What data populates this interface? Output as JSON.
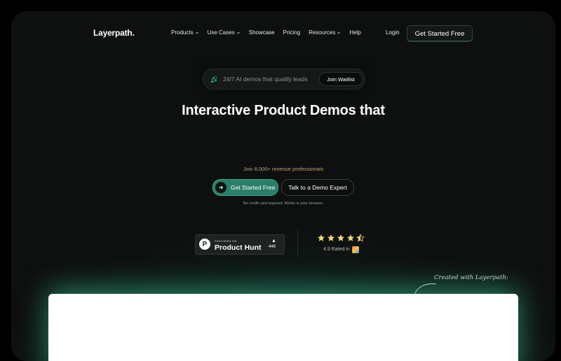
{
  "nav": {
    "logo": "Layerpath",
    "logo_dot": ".",
    "items": [
      {
        "label": "Products",
        "dropdown": true
      },
      {
        "label": "Use Cases",
        "dropdown": true
      },
      {
        "label": "Showcase",
        "dropdown": false
      },
      {
        "label": "Pricing",
        "dropdown": false
      },
      {
        "label": "Resources",
        "dropdown": true
      },
      {
        "label": "Help",
        "dropdown": false
      }
    ],
    "login": "Login",
    "cta": "Get Started Free"
  },
  "announcement": {
    "icon": "party-popper-icon",
    "text": "24/7 AI demos that qualify leads",
    "button": "Join Waitlist"
  },
  "hero": {
    "title": "Interactive Product Demos that",
    "social_proof": "Join 8,000+ revenue professionals",
    "primary_cta": "Get Started Free",
    "secondary_cta": "Talk to a Demo Expert",
    "note": "No credit card required. Works in your browser."
  },
  "product_hunt": {
    "featured": "FEATURED ON",
    "name": "Product Hunt",
    "count": "446"
  },
  "rating": {
    "stars": 4.5,
    "text": "4.9 Rated in"
  },
  "created_with": "Created with Layerpath:",
  "colors": {
    "background": "#0e1010",
    "accent": "#2a7f68",
    "glow": "#28be91",
    "star": "#f2dc7a"
  }
}
